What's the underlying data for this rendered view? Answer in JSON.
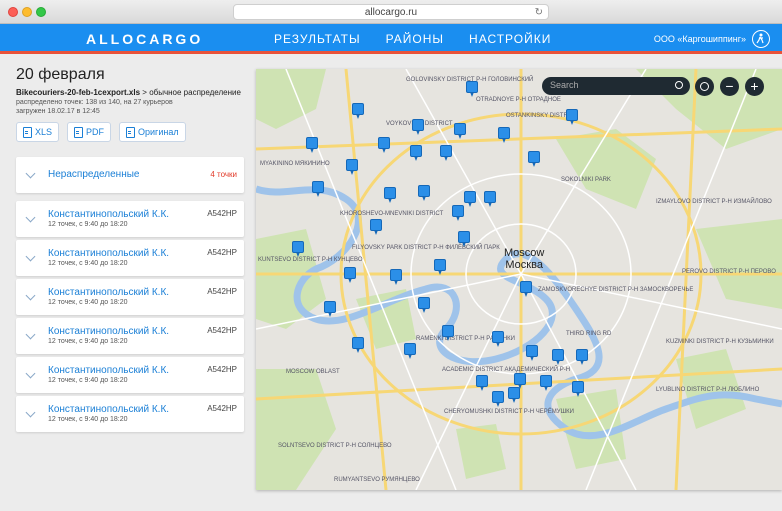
{
  "browser": {
    "url": "allocargo.ru"
  },
  "header": {
    "logo": "ALLOCARGO",
    "nav": [
      "РЕЗУЛЬТАТЫ",
      "РАЙОНЫ",
      "НАСТРОЙКИ"
    ],
    "company": "ООО «Каргошиппинг»"
  },
  "summary": {
    "date": "20 февраля",
    "file_name": "Bikecouriers-20-feb-1cexport.xls",
    "file_separator": " > ",
    "distribution": "обычное распределение",
    "stats": "распределено точек: 138 из 140, на 27 курьеров",
    "uploaded": "загружен 18.02.17 в 12:45",
    "buttons": [
      "XLS",
      "PDF",
      "Оригинал"
    ]
  },
  "unassigned": {
    "label": "Нераспределенные",
    "count": "4 точки"
  },
  "couriers": [
    {
      "name": "Константинопольский К.К.",
      "detail": "12 точек, с 9:40 до 18:20",
      "plate": "А542НР"
    },
    {
      "name": "Константинопольский К.К.",
      "detail": "12 точек, с 9:40 до 18:20",
      "plate": "А542НР"
    },
    {
      "name": "Константинопольский К.К.",
      "detail": "12 точек, с 9:40 до 18:20",
      "plate": "А542НР"
    },
    {
      "name": "Константинопольский К.К.",
      "detail": "12 точек, с 9:40 до 18:20",
      "plate": "А542НР"
    },
    {
      "name": "Константинопольский К.К.",
      "detail": "12 точек, с 9:40 до 18:20",
      "plate": "А542НР"
    },
    {
      "name": "Константинопольский К.К.",
      "detail": "12 точек, с 9:40 до 18:20",
      "plate": "А542НР"
    }
  ],
  "map": {
    "search_placeholder": "Search",
    "zoom_out": "−",
    "zoom_in": "+",
    "city_en": "Moscow",
    "city_ru": "Москва",
    "labels": [
      "GOLOVINSKY DISTRICT Р-Н ГОЛОВИНСКИЙ",
      "OTRADNOYE Р-Н ОТРАДНОЕ",
      "OSTANKINSKY DISTRICT",
      "VOYKOVSKY DISTRICT",
      "Myakinino Мякинино",
      "Sokolniki Park",
      "KHOROSHEVO-MNEVNIKI DISTRICT",
      "FILYOVSKY PARK DISTRICT Р-Н ФИЛЁВСКИЙ ПАРК",
      "KUNTSEVO DISTRICT Р-Н КУНЦЕВО",
      "ZAMOSKVORECHYE DISTRICT Р-Н ЗАМОСКВОРЕЧЬЕ",
      "RAMENKI DISTRICT Р-Н РАМЕНКИ",
      "ACADEMIC DISTRICT АКАДЕМИЧЕСКИЙ Р-Н",
      "CHERYOMUSHKI DISTRICT Р-Н ЧЕРЁМУШКИ",
      "SOLNTSEVO DISTRICT Р-Н СОЛНЦЕВО",
      "Rumyantsevo Румянцево",
      "IZMAYLOVO DISTRICT Р-Н ИЗМАЙЛОВО",
      "PEROVO DISTRICT Р-Н ПЕРОВО",
      "KUZMINKI DISTRICT Р-Н КУЗЬМИНКИ",
      "LYUBLINO DISTRICT Р-Н ЛЮБЛИНО",
      "MOSCOW OBLAST",
      "Third Ring Rd"
    ]
  }
}
